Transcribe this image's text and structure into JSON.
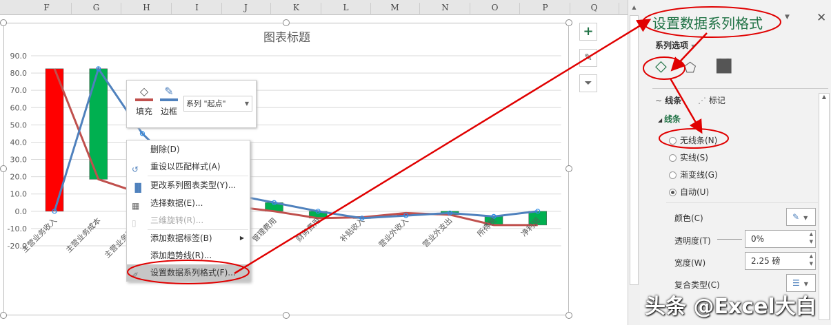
{
  "columns": [
    "F",
    "G",
    "H",
    "I",
    "J",
    "K",
    "L",
    "M",
    "N",
    "O",
    "P",
    "Q"
  ],
  "chart": {
    "title": "图表标题"
  },
  "chart_data": {
    "type": "bar",
    "title": "图表标题",
    "categories": [
      "主营业务收入",
      "主营业务成本",
      "主营业务税金及",
      "",
      "",
      "管理费用",
      "财务费用",
      "补贴收入",
      "营业外收入",
      "营业外支出",
      "所得税",
      "净利润"
    ],
    "yticks": [
      "90.0",
      "80.0",
      "70.0",
      "60.0",
      "50.0",
      "40.0",
      "30.0",
      "20.0",
      "10.0",
      "0.0",
      "-10.0",
      "-20.0"
    ],
    "ylim": [
      -20,
      90
    ],
    "grid": true,
    "bars": [
      [
        0,
        82.5,
        "#ff0000"
      ],
      [
        18.5,
        82.5,
        "#00b050"
      ],
      null,
      null,
      null,
      [
        0,
        5,
        "#00b050"
      ],
      [
        -4,
        0,
        "#00b050"
      ],
      [
        -4,
        -3,
        "#ff0000"
      ],
      [
        -2.5,
        -1,
        "#ff0000"
      ],
      [
        -2,
        0,
        "#00b050"
      ],
      [
        -8,
        -3,
        "#00b050"
      ],
      [
        -8,
        0,
        "#00b050"
      ]
    ],
    "series": [
      {
        "color": "#c0504d",
        "values": [
          82.5,
          18.5,
          10,
          6,
          3,
          0,
          -4,
          -3.5,
          -1,
          -2,
          -8,
          -8
        ]
      },
      {
        "color": "#4f81bd",
        "values": [
          0,
          82.5,
          45,
          20,
          10,
          5,
          0,
          -4,
          -2.5,
          -1,
          -3,
          0
        ]
      }
    ]
  },
  "side_buttons": {
    "add": "+",
    "style": "✎",
    "filter": "⏷"
  },
  "mini_toolbar": {
    "fill": "填充",
    "border": "边框",
    "series_select": "系列 \"起点\""
  },
  "context_menu": [
    {
      "label": "删除(D)",
      "disabled": false
    },
    {
      "label": "重设以匹配样式(A)",
      "disabled": false
    },
    {
      "label": "更改系列图表类型(Y)...",
      "disabled": false
    },
    {
      "label": "选择数据(E)...",
      "disabled": false
    },
    {
      "label": "三维旋转(R)...",
      "disabled": true
    },
    {
      "label": "添加数据标签(B)",
      "disabled": false
    },
    {
      "label": "添加趋势线(R)...",
      "disabled": false
    },
    {
      "label": "设置数据系列格式(F)...",
      "disabled": false
    }
  ],
  "panel": {
    "title": "设置数据系列格式",
    "series_options": "系列选项",
    "tab_line": "线条",
    "tab_marker": "标记",
    "section": "线条",
    "radios": [
      {
        "label": "无线条(N)",
        "checked": false
      },
      {
        "label": "实线(S)",
        "checked": false
      },
      {
        "label": "渐变线(G)",
        "checked": false
      },
      {
        "label": "自动(U)",
        "checked": true
      }
    ],
    "color_label": "颜色(C)",
    "transparency_label": "透明度(T)",
    "transparency_value": "0%",
    "width_label": "宽度(W)",
    "width_value": "2.25 磅",
    "compound_label": "复合类型(C)"
  },
  "watermark": "头条 @Excel大白",
  "annotation_color": "#e00000"
}
